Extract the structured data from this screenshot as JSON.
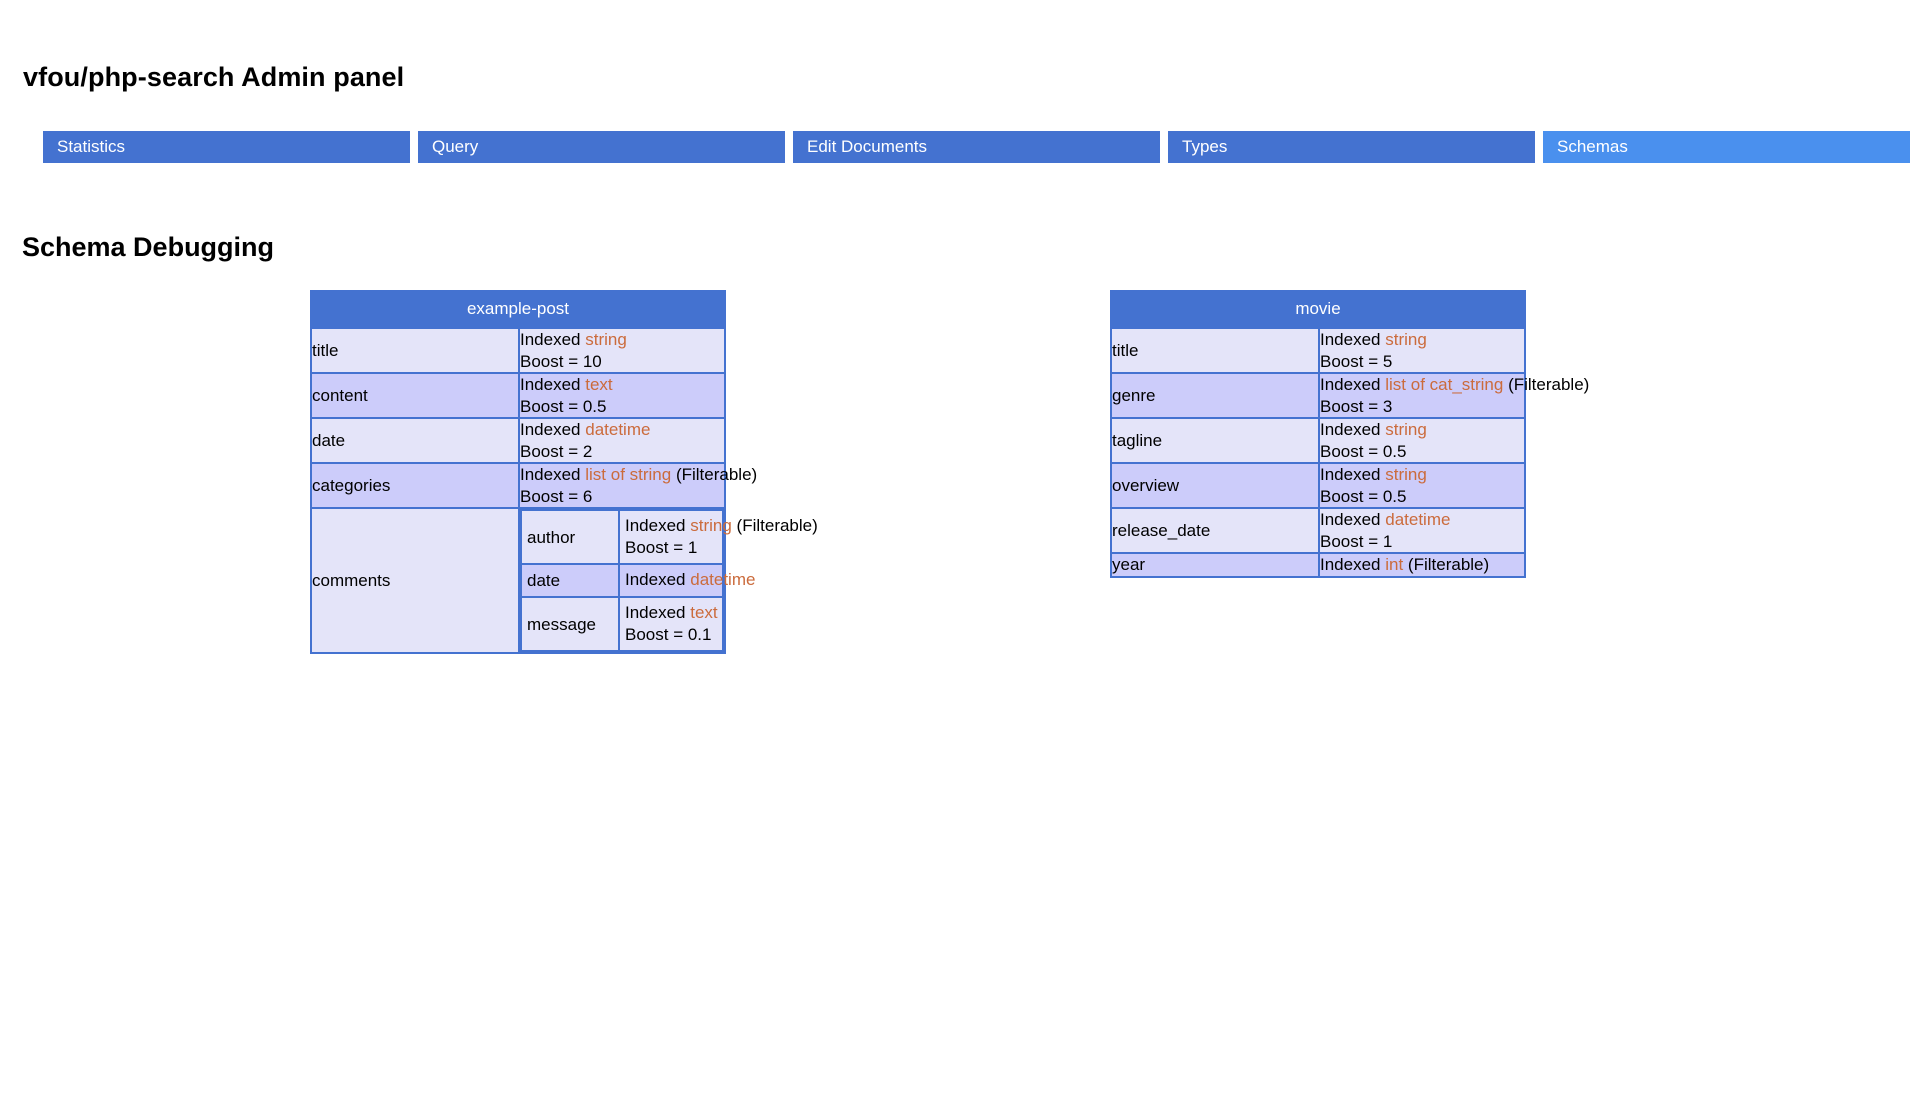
{
  "header": {
    "app_title": "vfou/php-search Admin panel",
    "section_title": "Schema Debugging"
  },
  "colors": {
    "tab_inactive": "#4472d0",
    "tab_active": "#4a90ee",
    "table_border": "#4472d0",
    "row_odd_bg": "#e4e4f9",
    "row_even_bg": "#ccccfa",
    "type_text": "#cb6b3c",
    "text": "#000000",
    "page_bg": "#ffffff"
  },
  "tabs": [
    {
      "label": "Statistics",
      "active": false
    },
    {
      "label": "Query",
      "active": false
    },
    {
      "label": "Edit Documents",
      "active": false
    },
    {
      "label": "Types",
      "active": false
    },
    {
      "label": "Schemas",
      "active": true
    }
  ],
  "schemas": [
    {
      "name": "example-post",
      "fields": [
        {
          "name": "title",
          "nested": false,
          "indexed_label": "Indexed",
          "type": "string",
          "filterable": "",
          "boost": "Boost = 10"
        },
        {
          "name": "content",
          "nested": false,
          "indexed_label": "Indexed",
          "type": "text",
          "filterable": "",
          "boost": "Boost = 0.5"
        },
        {
          "name": "date",
          "nested": false,
          "indexed_label": "Indexed",
          "type": "datetime",
          "filterable": "",
          "boost": "Boost = 2"
        },
        {
          "name": "categories",
          "nested": false,
          "indexed_label": "Indexed",
          "type": "list of string",
          "filterable": " (Filterable)",
          "boost": "Boost = 6"
        },
        {
          "name": "comments",
          "nested": true,
          "subfields": [
            {
              "name": "author",
              "indexed_label": "Indexed",
              "type": "string",
              "filterable": " (Filterable)",
              "boost": "Boost = 1"
            },
            {
              "name": "date",
              "indexed_label": "Indexed",
              "type": "datetime",
              "filterable": "",
              "boost": ""
            },
            {
              "name": "message",
              "indexed_label": "Indexed",
              "type": "text",
              "filterable": "",
              "boost": "Boost = 0.1"
            }
          ]
        }
      ]
    },
    {
      "name": "movie",
      "fields": [
        {
          "name": "title",
          "nested": false,
          "indexed_label": "Indexed",
          "type": "string",
          "filterable": "",
          "boost": "Boost = 5"
        },
        {
          "name": "genre",
          "nested": false,
          "indexed_label": "Indexed",
          "type": "list of cat_string",
          "filterable": " (Filterable)",
          "boost": "Boost = 3"
        },
        {
          "name": "tagline",
          "nested": false,
          "indexed_label": "Indexed",
          "type": "string",
          "filterable": "",
          "boost": "Boost = 0.5"
        },
        {
          "name": "overview",
          "nested": false,
          "indexed_label": "Indexed",
          "type": "string",
          "filterable": "",
          "boost": "Boost = 0.5"
        },
        {
          "name": "release_date",
          "nested": false,
          "indexed_label": "Indexed",
          "type": "datetime",
          "filterable": "",
          "boost": "Boost = 1"
        },
        {
          "name": "year",
          "nested": false,
          "indexed_label": "Indexed",
          "type": "int",
          "filterable": " (Filterable)",
          "boost": ""
        }
      ]
    }
  ]
}
